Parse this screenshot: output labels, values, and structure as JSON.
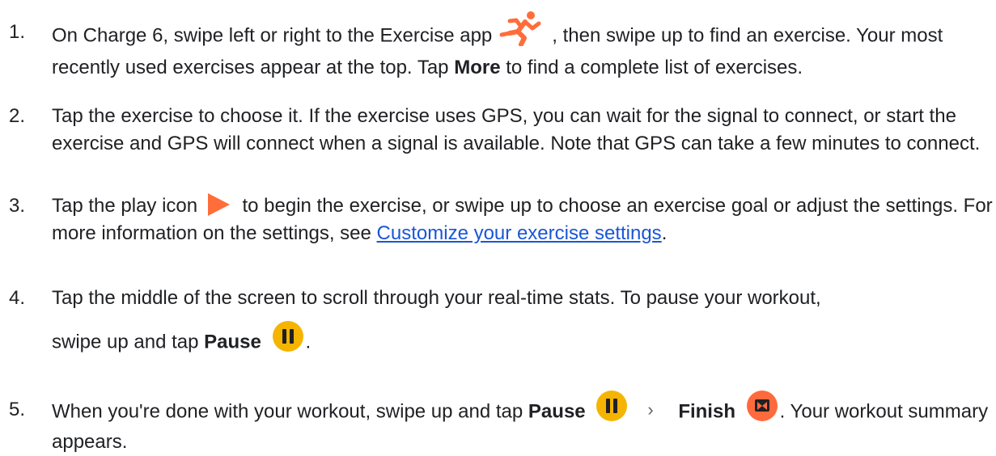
{
  "colors": {
    "text": "#202124",
    "link": "#1a56d6",
    "icon_orange": "#ff6d3a",
    "pause_yellow": "#f5b400",
    "finish_orange": "#ff6a3d"
  },
  "icons": {
    "exercise_app": "running-person-icon",
    "play": "play-icon",
    "pause": "pause-icon",
    "finish": "finish-flag-icon",
    "chevron": "chevron-right-icon"
  },
  "steps": [
    {
      "number": "1.",
      "text_a": "On Charge 6, swipe left or right to the Exercise app",
      "text_b": ", then swipe up to find an exercise. Your most recently used exercises appear at the top. Tap",
      "bold_more": "More",
      "text_c": "to find a complete list of exercises."
    },
    {
      "number": "2.",
      "text": "Tap the exercise to choose it. If the exercise uses GPS, you can wait for the signal to connect, or start the exercise and GPS will connect when a signal is available. Note that GPS can take a few minutes to connect."
    },
    {
      "number": "3.",
      "text_a": "Tap the play icon",
      "text_b": "to begin the exercise, or swipe up to choose an exercise goal or adjust the settings. For more information on the settings, see",
      "link": "Customize your exercise settings",
      "text_c": "."
    },
    {
      "number": "4.",
      "text_a": "Tap the middle of the screen to scroll through your real-time stats. To pause your workout,",
      "text_b": "swipe up and tap",
      "bold_pause": "Pause",
      "text_c": "."
    },
    {
      "number": "5.",
      "text_a": "When you're done with your workout, swipe up and tap",
      "bold_pause": "Pause",
      "chevron": "›",
      "bold_finish": "Finish",
      "text_b": ". Your workout summary appears."
    }
  ]
}
